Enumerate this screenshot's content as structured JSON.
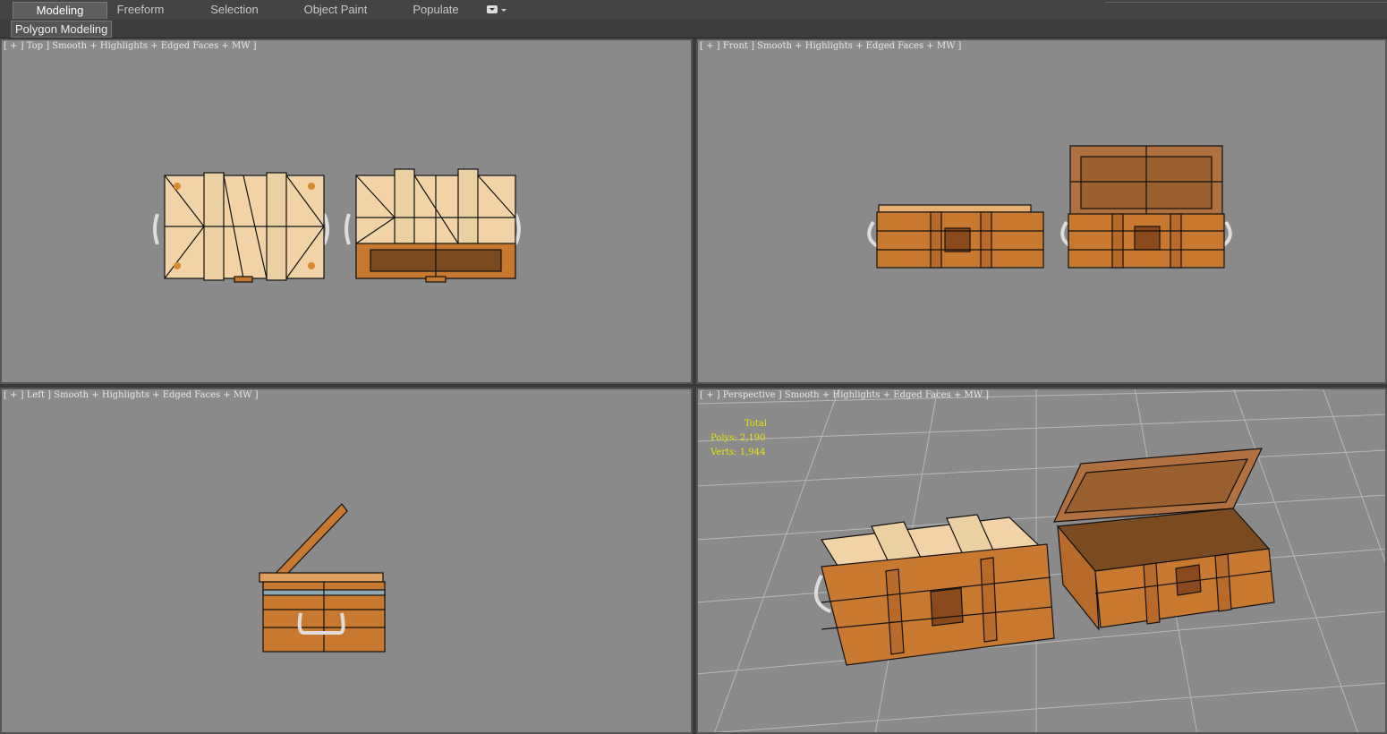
{
  "ribbon": {
    "tabs": [
      {
        "label": "Modeling",
        "active": true
      },
      {
        "label": "Freeform",
        "active": false
      },
      {
        "label": "Selection",
        "active": false
      },
      {
        "label": "Object Paint",
        "active": false
      },
      {
        "label": "Populate",
        "active": false
      }
    ],
    "dropdown_icon": "ribbon-options-icon",
    "panel_label": "Polygon Modeling"
  },
  "viewports": {
    "top": {
      "label": "[ + ] Top ] Smooth + Highlights + Edged Faces + MW ]"
    },
    "front": {
      "label": "[ + ] Front ] Smooth + Highlights + Edged Faces + MW ]"
    },
    "left": {
      "label": "[ + ] Left ] Smooth + Highlights + Edged Faces + MW ]"
    },
    "perspective": {
      "label": "[ + ] Perspective ] Smooth + Highlights + Edged Faces + MW ]",
      "stats": {
        "title": "Total",
        "polys": "Polys: 2,190",
        "verts": "Verts: 1,944"
      }
    }
  },
  "colors": {
    "viewport_bg": "#8a8a8a",
    "wood": "#c8782f",
    "wood_light": "#f2d3a8",
    "strap": "#b86a2a",
    "wire": "#1a1a1a",
    "stats_text": "#e5e600"
  }
}
